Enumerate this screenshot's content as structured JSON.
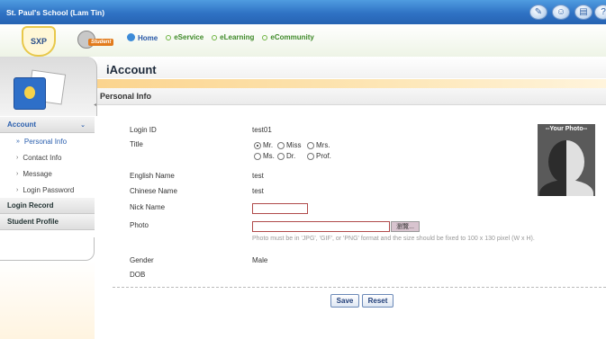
{
  "titlebar": {
    "school_name": "St. Paul's School (Lam Tin)",
    "icons": [
      "tools-icon",
      "smile-icon",
      "document-icon",
      "help-icon"
    ]
  },
  "header": {
    "crest_text": "SXP",
    "student_logo_label": "Student",
    "nav": [
      {
        "label": "Home",
        "icon": "home-icon"
      },
      {
        "label": "eService",
        "icon": "bullet-icon"
      },
      {
        "label": "eLearning",
        "icon": "bullet-icon"
      },
      {
        "label": "eCommunity",
        "icon": "bullet-icon"
      }
    ]
  },
  "page": {
    "title": "iAccount",
    "section_title": "Personal Info"
  },
  "sidebar": {
    "groups": [
      {
        "label": "Account",
        "chevron": "⌄"
      },
      {
        "label": "Login Record"
      },
      {
        "label": "Student Profile"
      }
    ],
    "account_items": [
      {
        "label": "Personal Info",
        "arrow": "»"
      },
      {
        "label": "Contact Info",
        "arrow": "›"
      },
      {
        "label": "Message",
        "arrow": "›"
      },
      {
        "label": "Login Password",
        "arrow": "›"
      }
    ]
  },
  "form": {
    "login_id_label": "Login ID",
    "login_id_value": "test01",
    "title_label": "Title",
    "title_options": [
      "Mr.",
      "Miss",
      "Mrs.",
      "Ms.",
      "Dr.",
      "Prof."
    ],
    "title_selected": "Mr.",
    "english_name_label": "English Name",
    "english_name_value": "test",
    "chinese_name_label": "Chinese Name",
    "chinese_name_value": "test",
    "nick_name_label": "Nick Name",
    "nick_name_value": "",
    "photo_label": "Photo",
    "photo_value": "",
    "browse_label": "瀏覽...",
    "photo_note": "Photo must be in 'JPG', 'GIF', or 'PNG' format and the size should be fixed to 100 x 130 pixel (W x H).",
    "gender_label": "Gender",
    "gender_value": "Male",
    "dob_label": "DOB",
    "dob_value": "",
    "photo_caption": "--Your Photo--"
  },
  "actions": {
    "save_label": "Save",
    "reset_label": "Reset"
  }
}
